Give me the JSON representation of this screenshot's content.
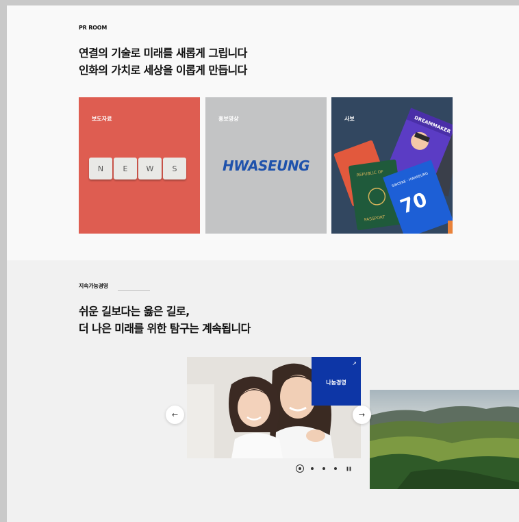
{
  "pr_room": {
    "eyebrow": "PR ROOM",
    "headline_line1": "연결의 기술로 미래를 새롭게 그립니다",
    "headline_line2": "인화의 가치로 세상을 이롭게 만듭니다",
    "cards": [
      {
        "label": "보도자료",
        "image": "news-letter-tiles",
        "tiles": [
          "N",
          "E",
          "W",
          "S"
        ],
        "bg": "#de5d51"
      },
      {
        "label": "홍보영상",
        "image": "hwaseung-logo",
        "logo_text": "HWASEUNG",
        "bg": "#c3c4c5",
        "logo_color": "#1f52ac"
      },
      {
        "label": "사보",
        "image": "passports-and-magazines",
        "bg": "#324760"
      }
    ]
  },
  "sustainability": {
    "eyebrow": "지속가능경영",
    "headline_line1": "쉬운 길보다는 옳은 길로,",
    "headline_line2": "더 나은 미래를 위한 탐구는 계속됩니다",
    "slides": [
      {
        "tag": "나눔경영",
        "image": "mother-and-daughter-photo",
        "tag_color": "#0d36a6"
      },
      {
        "image": "green-hills-landscape-photo"
      }
    ],
    "prev_icon": "arrow-left-icon",
    "next_icon": "arrow-right-icon",
    "pagination": {
      "count": 4,
      "active": 1
    },
    "pause_icon": "pause-icon"
  }
}
